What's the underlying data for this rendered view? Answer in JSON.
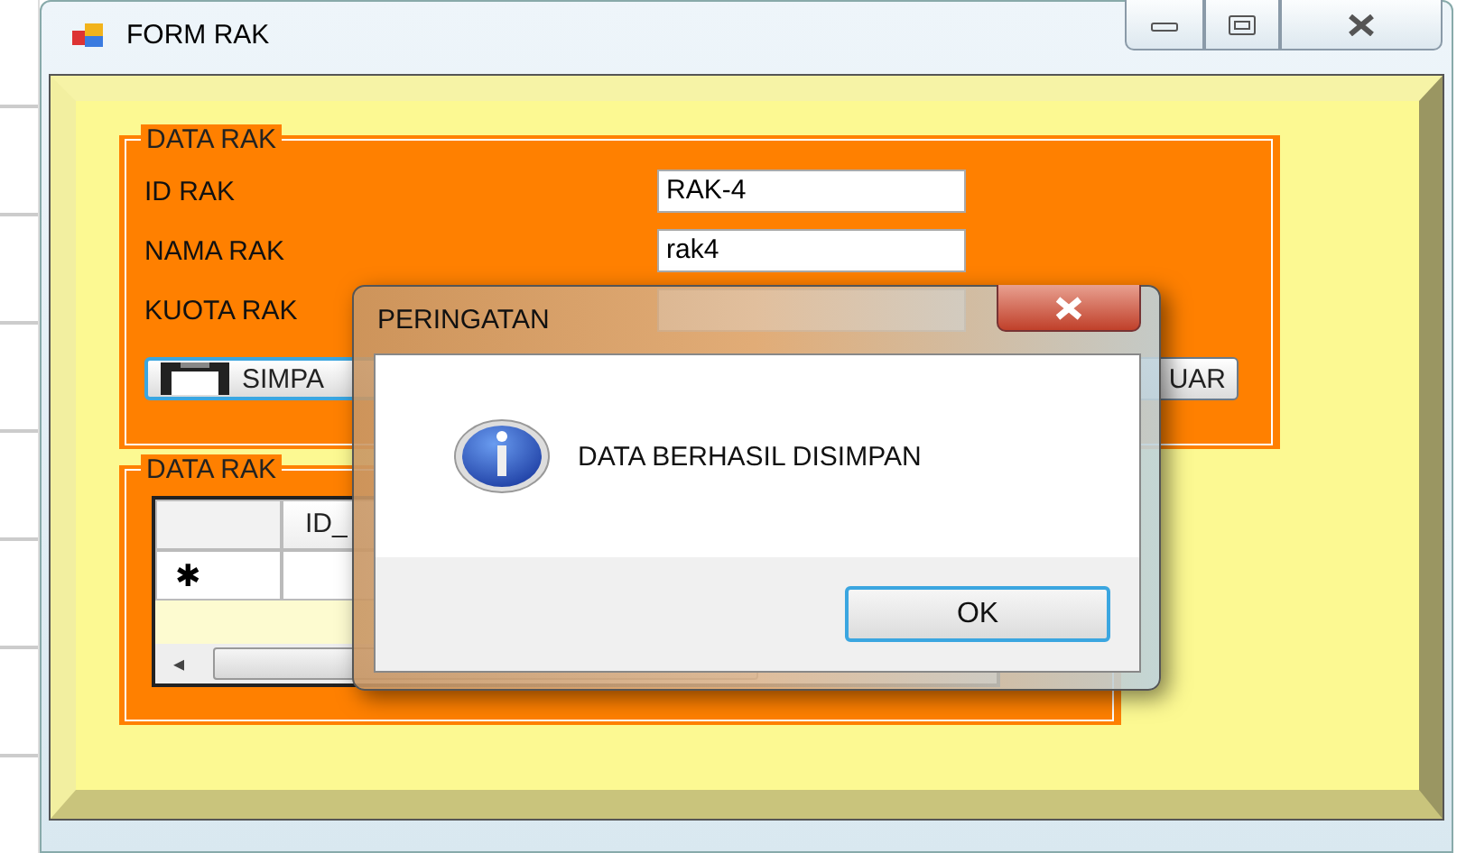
{
  "window": {
    "title": "FORM RAK"
  },
  "group_1": {
    "title": "DATA RAK",
    "fields": [
      {
        "label": "ID RAK",
        "value": "RAK-4"
      },
      {
        "label": "NAMA RAK",
        "value": "rak4"
      },
      {
        "label": "KUOTA RAK"
      }
    ],
    "buttons": [
      {
        "label": "SIMPA",
        "kind": "save"
      },
      {
        "label": "UAR",
        "kind": "plain"
      }
    ]
  },
  "group_2": {
    "title": "DATA RAK",
    "grid": {
      "columns": [
        "ID_"
      ],
      "new_row_marker": "✱",
      "scroll_left": "◂"
    }
  },
  "dialog": {
    "title": "PERINGATAN",
    "message": "DATA BERHASIL DISIMPAN",
    "button": "OK"
  }
}
